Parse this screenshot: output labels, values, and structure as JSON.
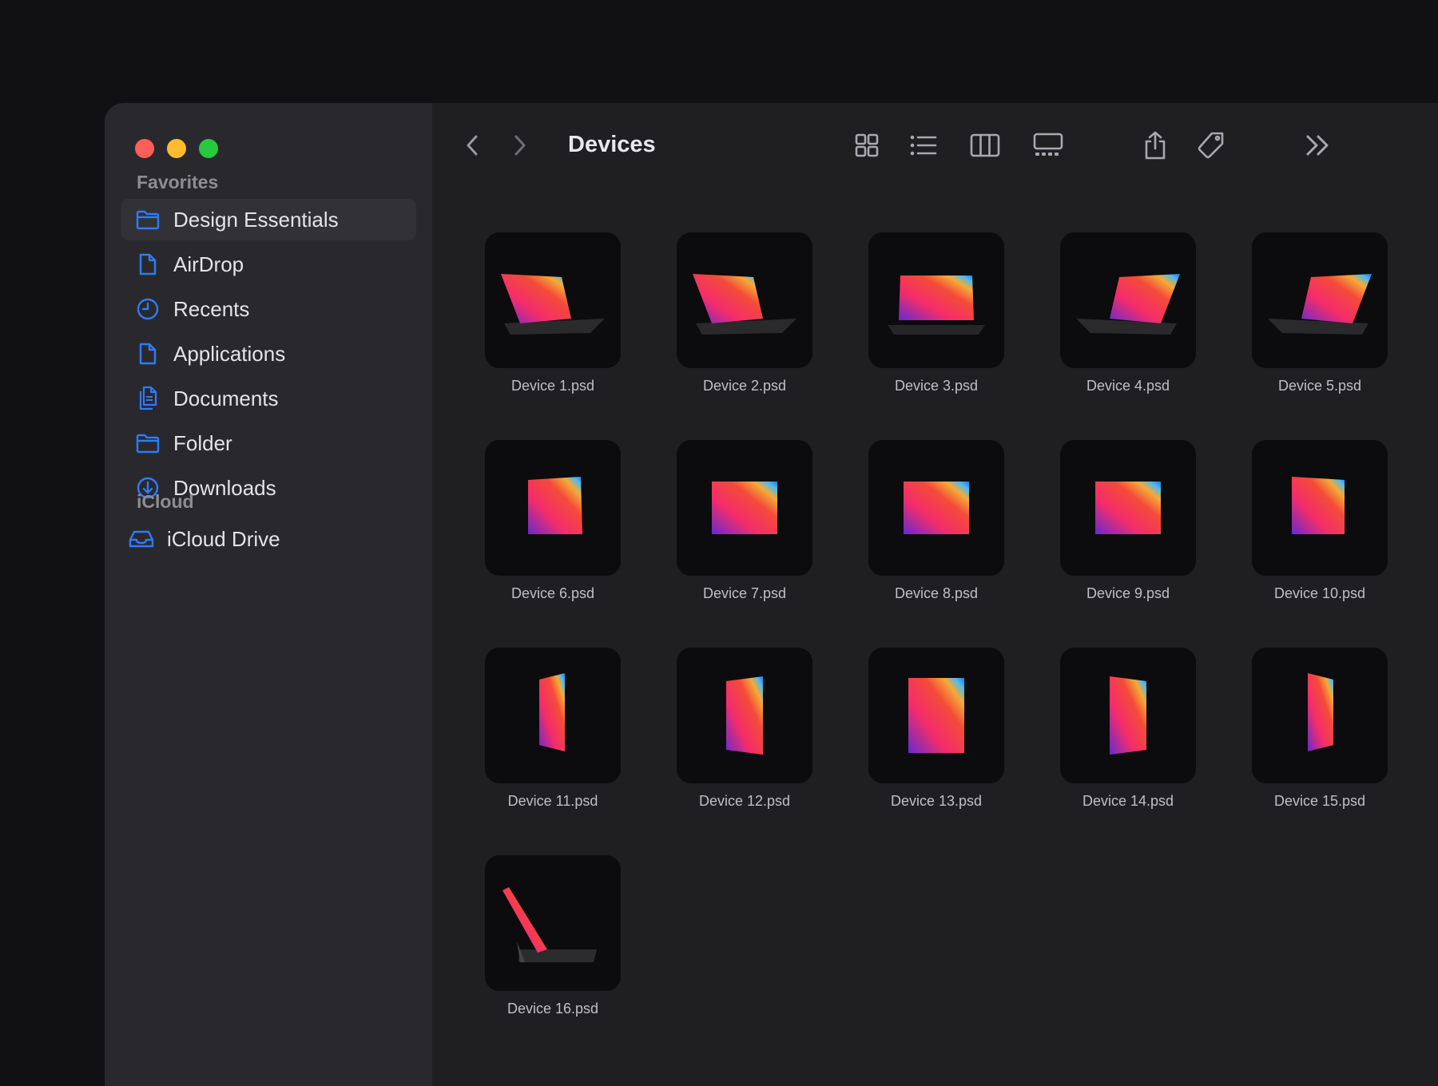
{
  "window": {
    "title": "Devices"
  },
  "sidebar": {
    "favorites_label": "Favorites",
    "favorites": [
      {
        "label": "Design Essentials",
        "icon": "folder-icon",
        "active": true
      },
      {
        "label": "AirDrop",
        "icon": "document-icon",
        "active": false
      },
      {
        "label": "Recents",
        "icon": "clock-icon",
        "active": false
      },
      {
        "label": "Applications",
        "icon": "document-icon",
        "active": false
      },
      {
        "label": "Documents",
        "icon": "documents-icon",
        "active": false
      },
      {
        "label": "Folder",
        "icon": "folder-icon",
        "active": false
      },
      {
        "label": "Downloads",
        "icon": "download-icon",
        "active": false
      }
    ],
    "icloud_label": "iCloud",
    "icloud": [
      {
        "label": "iCloud Drive",
        "icon": "drive-icon"
      }
    ]
  },
  "toolbar": {
    "icons": [
      "chevron-left-icon",
      "chevron-right-icon",
      "grid-view-icon",
      "list-view-icon",
      "column-view-icon",
      "gallery-view-icon",
      "share-icon",
      "tag-icon",
      "more-chevrons-icon"
    ]
  },
  "files": [
    {
      "name": "Device 1.psd",
      "kind": "keyboard-left"
    },
    {
      "name": "Device 2.psd",
      "kind": "keyboard-left"
    },
    {
      "name": "Device 3.psd",
      "kind": "keyboard-front"
    },
    {
      "name": "Device 4.psd",
      "kind": "keyboard-right"
    },
    {
      "name": "Device 5.psd",
      "kind": "keyboard-right"
    },
    {
      "name": "Device 6.psd",
      "kind": "landscape-left"
    },
    {
      "name": "Device 7.psd",
      "kind": "landscape-front"
    },
    {
      "name": "Device 8.psd",
      "kind": "landscape-front"
    },
    {
      "name": "Device 9.psd",
      "kind": "landscape-front"
    },
    {
      "name": "Device 10.psd",
      "kind": "landscape-right"
    },
    {
      "name": "Device 11.psd",
      "kind": "portrait-side"
    },
    {
      "name": "Device 12.psd",
      "kind": "portrait-left"
    },
    {
      "name": "Device 13.psd",
      "kind": "portrait-front"
    },
    {
      "name": "Device 14.psd",
      "kind": "portrait-right"
    },
    {
      "name": "Device 15.psd",
      "kind": "portrait-side-right"
    },
    {
      "name": "Device 16.psd",
      "kind": "keyboard-folded"
    }
  ],
  "colors": {
    "accent": "#2f7bf6",
    "sidebar_bg": "#29292d",
    "main_bg": "#1f1f22"
  }
}
